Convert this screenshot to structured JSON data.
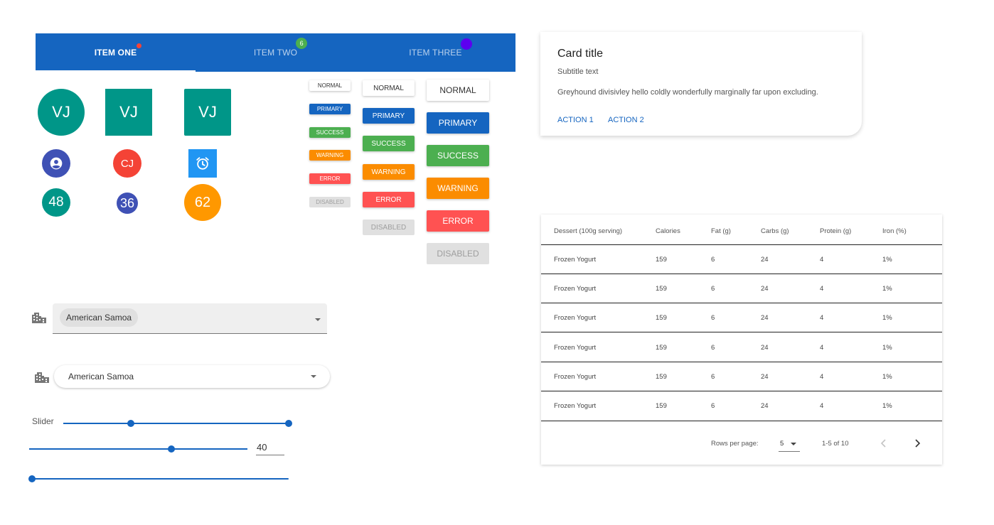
{
  "tabs": [
    {
      "label": "ITEM ONE",
      "active": true,
      "badge": "dot"
    },
    {
      "label": "ITEM TWO",
      "active": false,
      "badge": "6"
    },
    {
      "label": "ITEM THREE",
      "active": false,
      "badge": "dot"
    }
  ],
  "avatars": {
    "row1": [
      "VJ",
      "VJ",
      "VJ"
    ],
    "row2": {
      "person_icon": "account-circle-icon",
      "initials": "CJ",
      "alarm_icon": "alarm-clock-icon"
    },
    "row3": [
      "48",
      "36",
      "62"
    ]
  },
  "buttons": {
    "labels": [
      "NORMAL",
      "PRIMARY",
      "SUCCESS",
      "WARNING",
      "ERROR",
      "DISABLED"
    ]
  },
  "card": {
    "title": "Card title",
    "subtitle": "Subtitle text",
    "text": "Greyhound divisivley hello coldly wonderfully marginally far upon excluding.",
    "action1": "ACTION 1",
    "action2": "ACTION 2"
  },
  "table": {
    "headers": [
      "Dessert (100g serving)",
      "Calories",
      "Fat (g)",
      "Carbs (g)",
      "Protein (g)",
      "Iron (%)"
    ],
    "rows": [
      [
        "Frozen Yogurt",
        "159",
        "6",
        "24",
        "4",
        "1%"
      ],
      [
        "Frozen Yogurt",
        "159",
        "6",
        "24",
        "4",
        "1%"
      ],
      [
        "Frozen Yogurt",
        "159",
        "6",
        "24",
        "4",
        "1%"
      ],
      [
        "Frozen Yogurt",
        "159",
        "6",
        "24",
        "4",
        "1%"
      ],
      [
        "Frozen Yogurt",
        "159",
        "6",
        "24",
        "4",
        "1%"
      ],
      [
        "Frozen Yogurt",
        "159",
        "6",
        "24",
        "4",
        "1%"
      ]
    ],
    "pagination": {
      "rows_per_page_label": "Rows per page:",
      "rows_per_page_value": "5",
      "range": "1-5 of 10"
    }
  },
  "select1": {
    "icon": "city-icon",
    "chip": "American Samoa"
  },
  "select2": {
    "icon": "city-icon",
    "value": "American Samoa"
  },
  "sliders": {
    "label": "Slider",
    "range_values": [
      0.3,
      1.0
    ],
    "slider2_value": "40",
    "slider2_fraction": 0.65,
    "discrete_value": 0,
    "discrete_steps": 8
  },
  "colors": {
    "primary": "#1565c0",
    "teal": "#009688",
    "indigo": "#3f51b5",
    "red": "#f44336",
    "blue": "#2196f3",
    "orange": "#ff9800",
    "success": "#4caf50",
    "warning": "#fb8c00",
    "error": "#ff5252"
  }
}
